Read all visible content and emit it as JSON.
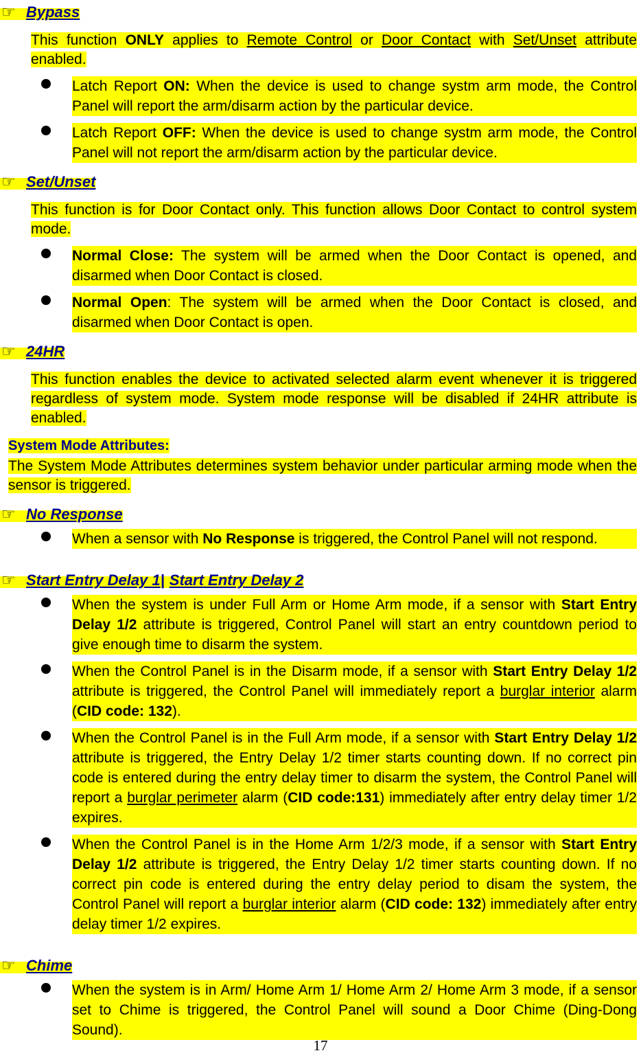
{
  "document": {
    "page_number": "17",
    "colors": {
      "highlight": "#FFFF00",
      "heading_blue": "#00008F",
      "body_text": "#000000"
    },
    "icons": {
      "pointing_hand": "☞",
      "bullet": "●"
    }
  },
  "sections": [
    {
      "id": "bypass",
      "heading": "Bypass",
      "intro": {
        "parts": [
          {
            "text": "This function ",
            "style": "normal"
          },
          {
            "text": "ONLY",
            "style": "bold"
          },
          {
            "text": " applies to ",
            "style": "normal"
          },
          {
            "text": "Remote Control",
            "style": "underline"
          },
          {
            "text": " or ",
            "style": "normal"
          },
          {
            "text": "Door Contact",
            "style": "underline"
          },
          {
            "text": " with ",
            "style": "normal"
          },
          {
            "text": "Set/Unset",
            "style": "underline"
          },
          {
            "text": " attribute enabled.",
            "style": "normal"
          }
        ]
      },
      "bullets": [
        {
          "parts": [
            {
              "text": "Latch Report ",
              "style": "normal"
            },
            {
              "text": "ON:",
              "style": "bold"
            },
            {
              "text": " When the device is used to change systm arm mode, the Control Panel will report the arm/disarm action by the particular device.",
              "style": "normal"
            }
          ]
        },
        {
          "parts": [
            {
              "text": "Latch Report ",
              "style": "normal"
            },
            {
              "text": "OFF:",
              "style": "bold"
            },
            {
              "text": " When the device is used to change systm arm mode, the Control Panel will not report the arm/disarm action by the particular device.",
              "style": "normal"
            }
          ]
        }
      ]
    },
    {
      "id": "set-unset",
      "heading": "Set/Unset",
      "intro": {
        "parts": [
          {
            "text": "This function is for Door Contact only. This function allows Door Contact to control system mode.",
            "style": "normal"
          }
        ]
      },
      "bullets": [
        {
          "parts": [
            {
              "text": "Normal Close:",
              "style": "bold"
            },
            {
              "text": " The system will be armed when the Door Contact is opened, and disarmed when Door Contact is closed.",
              "style": "normal"
            }
          ]
        },
        {
          "parts": [
            {
              "text": "Normal Open",
              "style": "bold"
            },
            {
              "text": ": The system will be armed when the Door Contact is closed, and disarmed when Door Contact is open.",
              "style": "normal"
            }
          ]
        }
      ]
    },
    {
      "id": "24hr",
      "heading": "24HR",
      "intro": {
        "parts": [
          {
            "text": "This function enables the device to activated selected alarm event whenever it is triggered regardless of system mode. System mode response will be disabled if 24HR attribute is enabled.",
            "style": "normal"
          }
        ]
      },
      "bullets": []
    }
  ],
  "system_mode_block": {
    "heading": "System Mode Attributes:",
    "paragraph": "The System Mode Attributes determines system behavior under particular arming mode when the sensor is triggered."
  },
  "mode_sections": [
    {
      "id": "no-response",
      "heading": "No Response",
      "bullets": [
        {
          "parts": [
            {
              "text": "When a sensor with ",
              "style": "normal"
            },
            {
              "text": "No Response",
              "style": "bold"
            },
            {
              "text": " is triggered, the Control Panel will not respond.",
              "style": "normal"
            }
          ]
        }
      ]
    },
    {
      "id": "start-entry-delay",
      "heading_part_1": "Start Entry Delay 1",
      "heading_separator": "|",
      "heading_part_2": "Start Entry Delay 2",
      "bullets": [
        {
          "parts": [
            {
              "text": "When the system is under Full Arm or Home Arm mode, if a sensor with ",
              "style": "normal"
            },
            {
              "text": "Start Entry Delay 1/2",
              "style": "bold"
            },
            {
              "text": " attribute is triggered, Control Panel will start an entry countdown period to give enough time to disarm the system.",
              "style": "normal"
            }
          ]
        },
        {
          "parts": [
            {
              "text": "When the Control Panel is in the Disarm mode, if a sensor with ",
              "style": "normal"
            },
            {
              "text": "Start Entry Delay 1/2",
              "style": "bold"
            },
            {
              "text": " attribute is triggered, the Control Panel will immediately report a ",
              "style": "normal"
            },
            {
              "text": "burglar interior",
              "style": "underline"
            },
            {
              "text": " alarm (",
              "style": "normal"
            },
            {
              "text": "CID code: 132",
              "style": "bold"
            },
            {
              "text": ").",
              "style": "normal"
            }
          ]
        },
        {
          "parts": [
            {
              "text": "When the Control Panel is in the Full Arm mode, if a sensor with ",
              "style": "normal"
            },
            {
              "text": "Start Entry Delay 1/2",
              "style": "bold"
            },
            {
              "text": " attribute is triggered, the Entry Delay 1/2 timer starts counting down. If no correct pin code is entered during the entry delay timer to disarm the system, the Control Panel will report a ",
              "style": "normal"
            },
            {
              "text": "burglar perimeter",
              "style": "underline"
            },
            {
              "text": " alarm (",
              "style": "normal"
            },
            {
              "text": "CID code:131",
              "style": "bold"
            },
            {
              "text": ") immediately after entry delay timer 1/2 expires.",
              "style": "normal"
            }
          ]
        },
        {
          "parts": [
            {
              "text": "When the Control Panel is in the Home Arm 1/2/3 mode, if a sensor with ",
              "style": "normal"
            },
            {
              "text": "Start Entry Delay 1/2",
              "style": "bold"
            },
            {
              "text": " attribute is triggered, the Entry Delay 1/2 timer starts counting down.  If no correct pin code is entered during the entry delay period to disam the system, the Control Panel will report a ",
              "style": "normal"
            },
            {
              "text": "burglar interior",
              "style": "underline"
            },
            {
              "text": " alarm (",
              "style": "normal"
            },
            {
              "text": "CID code: 132",
              "style": "bold"
            },
            {
              "text": ") immediately after entry delay timer 1/2 expires.",
              "style": "normal"
            }
          ]
        }
      ]
    },
    {
      "id": "chime",
      "heading": "Chime",
      "bullets": [
        {
          "parts": [
            {
              "text": "When the system is in Arm/ Home Arm 1/ Home Arm 2/ Home Arm 3 mode, if a sensor set to Chime is triggered, the Control Panel will sound a Door Chime (Ding-Dong Sound).",
              "style": "normal"
            }
          ]
        }
      ]
    }
  ]
}
